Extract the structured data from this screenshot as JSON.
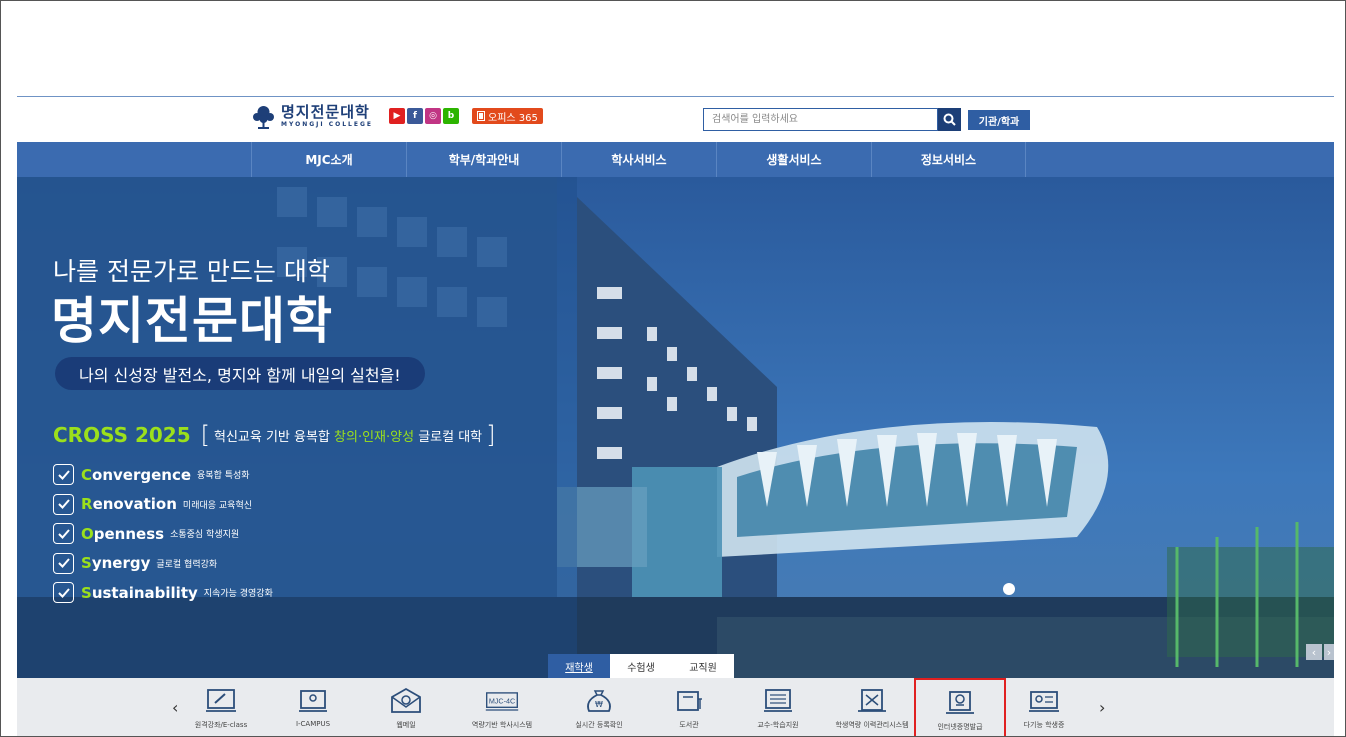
{
  "header": {
    "logo_main": "명지전문대학",
    "logo_sub": "MYONGJI COLLEGE",
    "sns": [
      {
        "icon": "youtube-icon",
        "glyph": "▶"
      },
      {
        "icon": "facebook-icon",
        "glyph": "f"
      },
      {
        "icon": "instagram-icon",
        "glyph": "◎"
      },
      {
        "icon": "blog-icon",
        "glyph": "b"
      }
    ],
    "office_label": "오피스 365",
    "search_placeholder": "검색어를 입력하세요",
    "org_button": "기관/학과"
  },
  "nav": {
    "items": [
      "MJC소개",
      "학부/학과안내",
      "학사서비스",
      "생활서비스",
      "정보서비스"
    ]
  },
  "hero": {
    "line1": "나를 전문가로 만드는 대학",
    "line2": "명지전문대학",
    "pill": "나의 신성장 발전소, 명지와 함께 내일의 실천을!",
    "cross_title": "CROSS 2025",
    "cross_desc_a": "혁신교육 기반 융복합 ",
    "cross_desc_hl": "창의·인재·양성",
    "cross_desc_b": " 글로컬 대학",
    "values": [
      {
        "first": "C",
        "rest": "onvergence",
        "desc": "융복합 특성화"
      },
      {
        "first": "R",
        "rest": "enovation",
        "desc": "미래대응 교육혁신"
      },
      {
        "first": "O",
        "rest": "penness",
        "desc": "소통중심 학생지원"
      },
      {
        "first": "S",
        "rest": "ynergy",
        "desc": "글로컬 협력강화"
      },
      {
        "first": "S",
        "rest": "ustainability",
        "desc": "지속가능 경영강화"
      }
    ],
    "tabs": [
      "재학생",
      "수험생",
      "교직원"
    ]
  },
  "quick": {
    "prev": "‹",
    "next": "›",
    "items": [
      {
        "label": "원격강좌/E-class",
        "icon": "eclass-icon"
      },
      {
        "label": "I-CAMPUS",
        "icon": "icampus-icon"
      },
      {
        "label": "웹메일",
        "icon": "webmail-icon"
      },
      {
        "label": "역량기반 학사시스템",
        "icon": "mjc4c-icon",
        "badge": "MJC-4C"
      },
      {
        "label": "실시간 등록확인",
        "icon": "registration-icon"
      },
      {
        "label": "도서관",
        "icon": "library-icon"
      },
      {
        "label": "교수-학습지원",
        "icon": "teaching-support-icon"
      },
      {
        "label": "학생역량 이력관리시스템",
        "icon": "student-record-icon"
      },
      {
        "label": "인터넷증명발급",
        "icon": "certificate-icon"
      },
      {
        "label": "다기능 학생증",
        "icon": "student-id-icon"
      }
    ]
  }
}
